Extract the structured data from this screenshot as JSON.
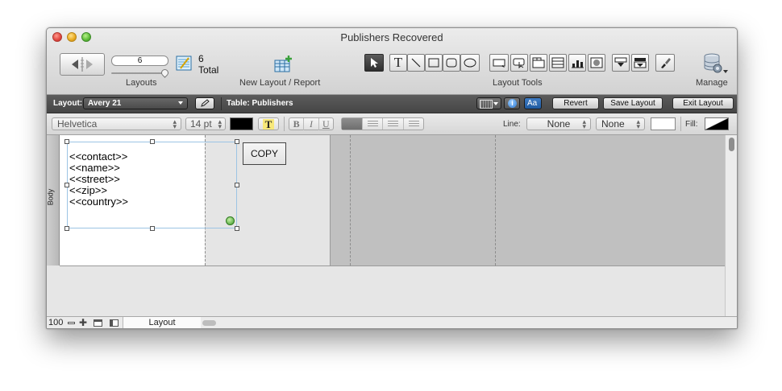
{
  "window": {
    "title": "Publishers Recovered"
  },
  "toolbar": {
    "record_value": "6",
    "record_total_count": "6",
    "record_total_label": "Total",
    "layouts_label": "Layouts",
    "new_layout_label": "New Layout / Report",
    "layout_tools_label": "Layout Tools",
    "manage_label": "Manage",
    "text_tool_glyph": "T"
  },
  "status_bar": {
    "layout_label": "Layout:",
    "layout_name": "Avery 21",
    "table_label": "Table: Publishers",
    "revert": "Revert",
    "save_layout": "Save Layout",
    "exit_layout": "Exit Layout"
  },
  "format_bar": {
    "font": "Helvetica",
    "size": "14 pt",
    "text_color": "#000000",
    "highlight_glyph": "T",
    "bold": "B",
    "italic": "I",
    "underline": "U",
    "line_label": "Line:",
    "line_style": "None",
    "line_width": "None",
    "fill_label": "Fill:"
  },
  "canvas": {
    "part_label": "Body",
    "fields": [
      "<<contact>>",
      "<<name>>",
      "<<street>>",
      "<<zip>>",
      "<<country>>"
    ],
    "copy_button": "COPY"
  },
  "bottom_bar": {
    "zoom": "100",
    "mode": "Layout"
  }
}
